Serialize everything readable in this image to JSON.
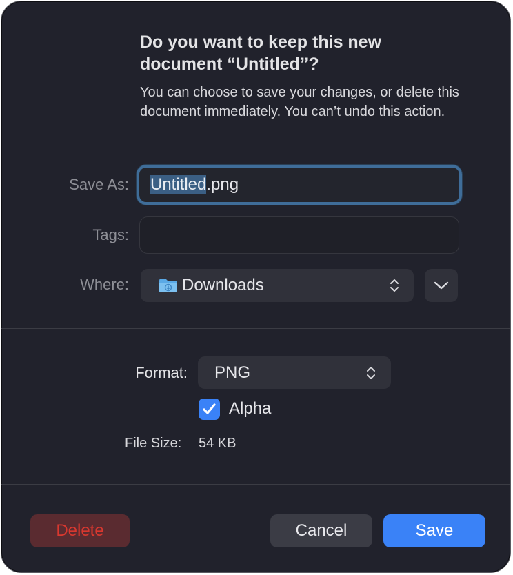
{
  "dialog": {
    "title": "Do you want to keep this new document “Untitled”?",
    "message": "You can choose to save your changes, or delete this document immediately. You can’t undo this action."
  },
  "save_as": {
    "label": "Save As:",
    "value_selected": "Untitled",
    "value_rest": ".png"
  },
  "tags": {
    "label": "Tags:",
    "value": ""
  },
  "where": {
    "label": "Where:",
    "selected": "Downloads",
    "icon": "folder-downloads-icon"
  },
  "format": {
    "label": "Format:",
    "selected": "PNG"
  },
  "alpha": {
    "label": "Alpha",
    "checked": true
  },
  "file_size": {
    "label": "File Size:",
    "value": "54 KB"
  },
  "buttons": {
    "delete": "Delete",
    "cancel": "Cancel",
    "save": "Save"
  },
  "colors": {
    "background": "#21222c",
    "accent": "#3a82f7",
    "destructive": "#d9382f",
    "focus_ring": "#3f6d99"
  }
}
